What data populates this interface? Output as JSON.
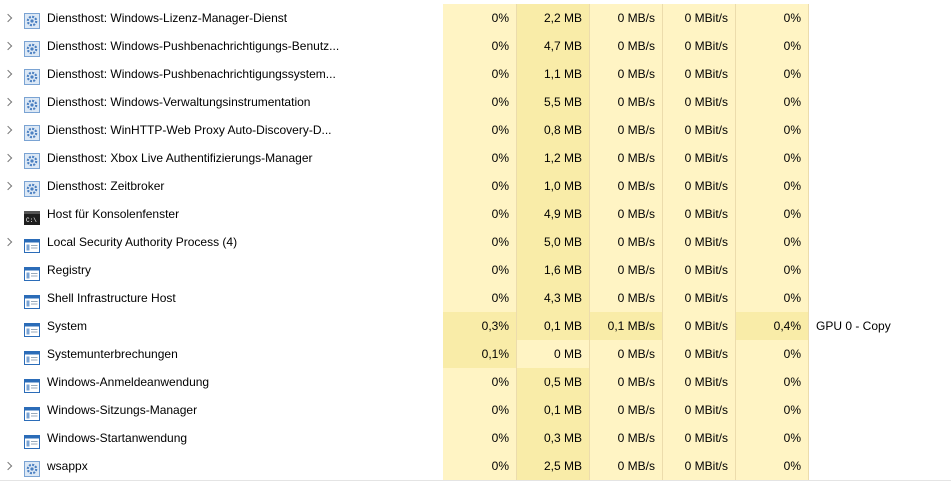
{
  "processes": [
    {
      "name": "Diensthost: Windows-Lizenz-Manager-Dienst",
      "expandable": true,
      "icon": "gear-icon",
      "cpu": "0%",
      "memory": "2,2 MB",
      "disk": "0 MB/s",
      "network": "0 MBit/s",
      "gpu": "0%",
      "gpu_engine": ""
    },
    {
      "name": "Diensthost: Windows-Pushbenachrichtigungs-Benutz...",
      "expandable": true,
      "icon": "gear-icon",
      "cpu": "0%",
      "memory": "4,7 MB",
      "disk": "0 MB/s",
      "network": "0 MBit/s",
      "gpu": "0%",
      "gpu_engine": ""
    },
    {
      "name": "Diensthost: Windows-Pushbenachrichtigungssystem...",
      "expandable": true,
      "icon": "gear-icon",
      "cpu": "0%",
      "memory": "1,1 MB",
      "disk": "0 MB/s",
      "network": "0 MBit/s",
      "gpu": "0%",
      "gpu_engine": ""
    },
    {
      "name": "Diensthost: Windows-Verwaltungsinstrumentation",
      "expandable": true,
      "icon": "gear-icon",
      "cpu": "0%",
      "memory": "5,5 MB",
      "disk": "0 MB/s",
      "network": "0 MBit/s",
      "gpu": "0%",
      "gpu_engine": ""
    },
    {
      "name": "Diensthost: WinHTTP-Web Proxy Auto-Discovery-D...",
      "expandable": true,
      "icon": "gear-icon",
      "cpu": "0%",
      "memory": "0,8 MB",
      "disk": "0 MB/s",
      "network": "0 MBit/s",
      "gpu": "0%",
      "gpu_engine": ""
    },
    {
      "name": "Diensthost: Xbox Live Authentifizierungs-Manager",
      "expandable": true,
      "icon": "gear-icon",
      "cpu": "0%",
      "memory": "1,2 MB",
      "disk": "0 MB/s",
      "network": "0 MBit/s",
      "gpu": "0%",
      "gpu_engine": ""
    },
    {
      "name": "Diensthost: Zeitbroker",
      "expandable": true,
      "icon": "gear-icon",
      "cpu": "0%",
      "memory": "1,0 MB",
      "disk": "0 MB/s",
      "network": "0 MBit/s",
      "gpu": "0%",
      "gpu_engine": ""
    },
    {
      "name": "Host für Konsolenfenster",
      "expandable": false,
      "icon": "console-icon",
      "cpu": "0%",
      "memory": "4,9 MB",
      "disk": "0 MB/s",
      "network": "0 MBit/s",
      "gpu": "0%",
      "gpu_engine": ""
    },
    {
      "name": "Local Security Authority Process (4)",
      "expandable": true,
      "icon": "window-icon",
      "cpu": "0%",
      "memory": "5,0 MB",
      "disk": "0 MB/s",
      "network": "0 MBit/s",
      "gpu": "0%",
      "gpu_engine": ""
    },
    {
      "name": "Registry",
      "expandable": false,
      "icon": "window-icon",
      "cpu": "0%",
      "memory": "1,6 MB",
      "disk": "0 MB/s",
      "network": "0 MBit/s",
      "gpu": "0%",
      "gpu_engine": ""
    },
    {
      "name": "Shell Infrastructure Host",
      "expandable": false,
      "icon": "window-icon",
      "cpu": "0%",
      "memory": "4,3 MB",
      "disk": "0 MB/s",
      "network": "0 MBit/s",
      "gpu": "0%",
      "gpu_engine": ""
    },
    {
      "name": "System",
      "expandable": false,
      "icon": "window-icon",
      "cpu": "0,3%",
      "memory": "0,1 MB",
      "disk": "0,1 MB/s",
      "network": "0 MBit/s",
      "gpu": "0,4%",
      "gpu_engine": "GPU 0 - Copy"
    },
    {
      "name": "Systemunterbrechungen",
      "expandable": false,
      "icon": "window-icon",
      "cpu": "0,1%",
      "memory": "0 MB",
      "disk": "0 MB/s",
      "network": "0 MBit/s",
      "gpu": "0%",
      "gpu_engine": ""
    },
    {
      "name": "Windows-Anmeldeanwendung",
      "expandable": false,
      "icon": "window-icon",
      "cpu": "0%",
      "memory": "0,5 MB",
      "disk": "0 MB/s",
      "network": "0 MBit/s",
      "gpu": "0%",
      "gpu_engine": ""
    },
    {
      "name": "Windows-Sitzungs-Manager",
      "expandable": false,
      "icon": "window-icon",
      "cpu": "0%",
      "memory": "0,1 MB",
      "disk": "0 MB/s",
      "network": "0 MBit/s",
      "gpu": "0%",
      "gpu_engine": ""
    },
    {
      "name": "Windows-Startanwendung",
      "expandable": false,
      "icon": "window-icon",
      "cpu": "0%",
      "memory": "0,3 MB",
      "disk": "0 MB/s",
      "network": "0 MBit/s",
      "gpu": "0%",
      "gpu_engine": ""
    },
    {
      "name": "wsappx",
      "expandable": true,
      "icon": "gear-icon",
      "cpu": "0%",
      "memory": "2,5 MB",
      "disk": "0 MB/s",
      "network": "0 MBit/s",
      "gpu": "0%",
      "gpu_engine": ""
    }
  ],
  "colors": {
    "heat_light": "#fff4c4",
    "heat_medium": "#f9eca8",
    "gear": "#4a7fc1",
    "console": "#1e1e1e",
    "window_blue": "#2b6cb8"
  }
}
